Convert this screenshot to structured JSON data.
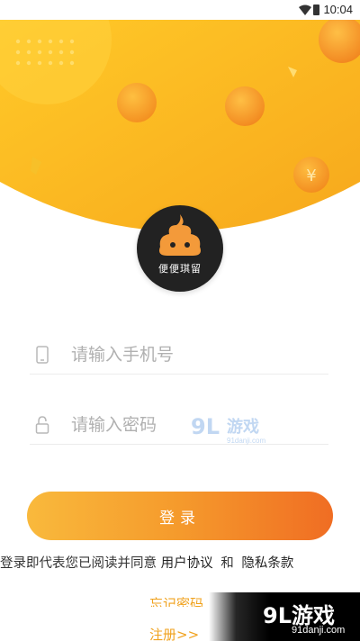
{
  "status_bar": {
    "time": "10:04"
  },
  "app": {
    "logo_text": "便便琪留"
  },
  "form": {
    "phone_placeholder": "请输入手机号",
    "password_placeholder": "请输入密码",
    "login_label": "登录"
  },
  "agreement": {
    "prefix": "登录即代表您已阅读并同意",
    "user_agreement": "用户协议",
    "conjunction": "和",
    "privacy_policy": "隐私条款"
  },
  "links": {
    "forgot_password": "忘记密码",
    "register": "注册>>"
  },
  "watermark": {
    "brand": "9L游戏",
    "domain": "91danji.com"
  },
  "colors": {
    "accent": "#f5a623",
    "button_start": "#f9b93c",
    "button_end": "#f06d23",
    "link": "#f0a21e"
  }
}
